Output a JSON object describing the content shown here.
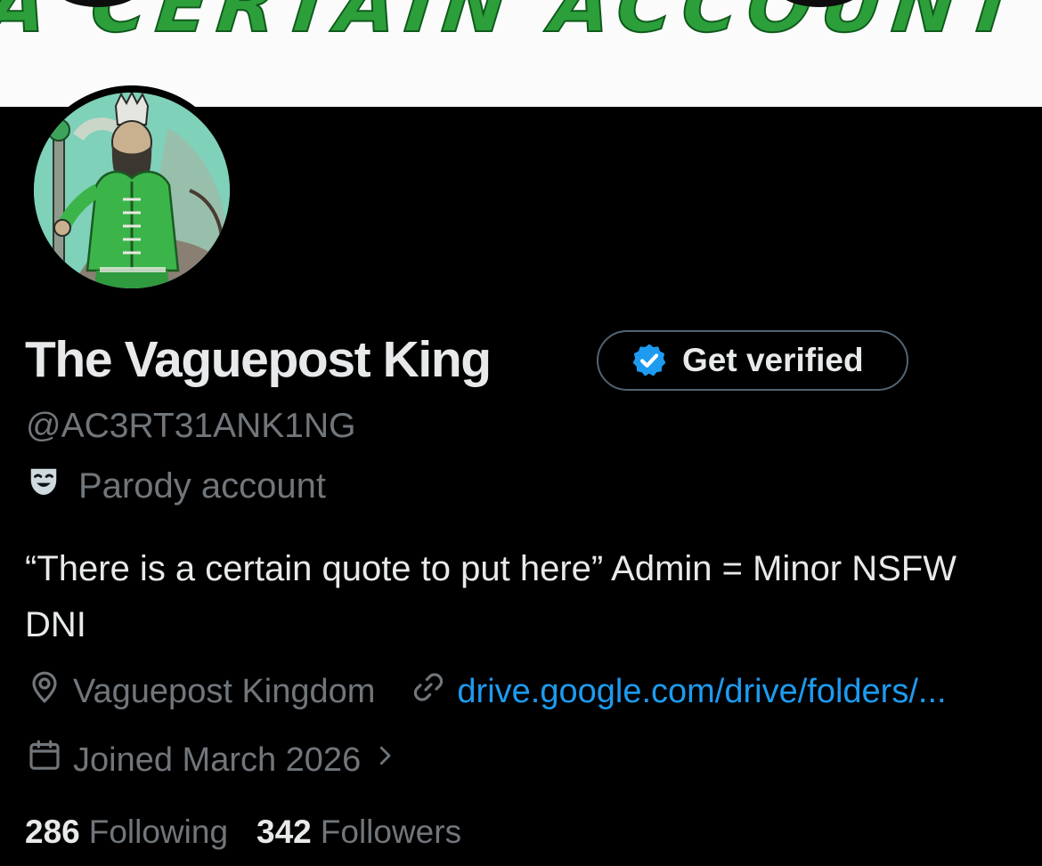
{
  "banner": {
    "text": "A CERTAIN ACCOUNT",
    "text_color": "#2c9f3a"
  },
  "profile": {
    "display_name": "The Vaguepost King",
    "handle": "@AC3RT31ANK1NG",
    "label": "Parody account",
    "label_icon": "parody-mask-icon",
    "bio": "“There is a certain quote to put here” Admin = Minor NSFW DNI",
    "location": "Vaguepost Kingdom",
    "location_icon": "location-pin-icon",
    "link": "drive.google.com/drive/folders/...",
    "link_icon": "link-icon",
    "joined": "Joined March 2026",
    "joined_icon": "calendar-icon",
    "following_count": "286",
    "following_label": "Following",
    "followers_count": "342",
    "followers_label": "Followers"
  },
  "actions": {
    "get_verified_label": "Get verified",
    "get_verified_icon": "verified-badge-icon"
  },
  "colors": {
    "background": "#000000",
    "primary_text": "#e7e9ea",
    "secondary_text": "#71767b",
    "link": "#1d9bf0",
    "verified_badge": "#1d9bf0"
  }
}
